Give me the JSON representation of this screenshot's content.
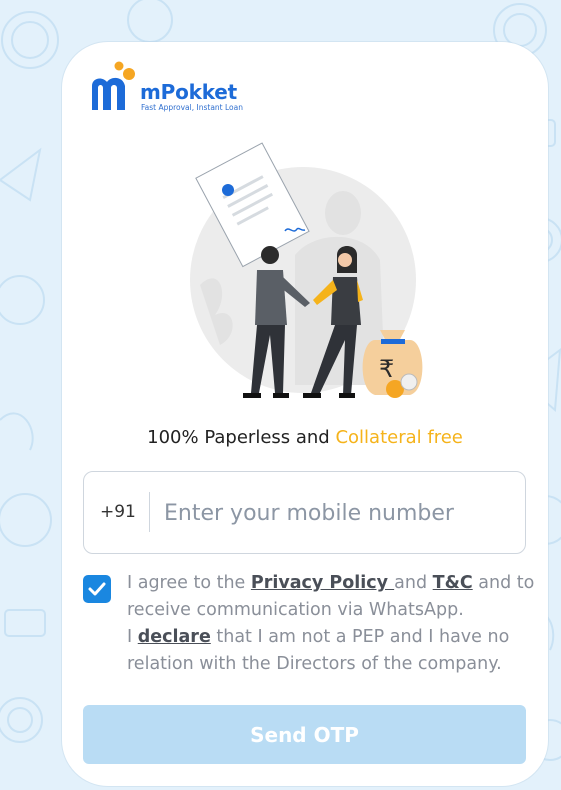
{
  "brand": {
    "name": "mPokket",
    "tagline": "Fast Approval, Instant Loan",
    "colors": {
      "primary": "#1d6bd8",
      "accent": "#f5a623"
    }
  },
  "illustration": {
    "icon": "handshake-loan-illustration",
    "currency_symbol": "₹"
  },
  "headline": {
    "text": "100% Paperless and ",
    "accent_text": "Collateral free",
    "accent_color": "#f5b31b"
  },
  "phone": {
    "country_code": "+91",
    "placeholder": "Enter your mobile number",
    "value": ""
  },
  "consent": {
    "checked": true,
    "text_1": "I agree to the ",
    "privacy_link": "Privacy Policy ",
    "text_2": " and ",
    "tc_link": "T&C",
    "text_3": " and to",
    "line_2": "receive communication via WhatsApp.",
    "text_4": "I ",
    "declare_link": "declare",
    "text_5": " that I am not a PEP and I have no",
    "line_4": "relation with the Directors of the company."
  },
  "send_button": {
    "label": "Send OTP",
    "color": "#b9dcf4"
  },
  "background": {
    "color": "#e3f1fb"
  }
}
